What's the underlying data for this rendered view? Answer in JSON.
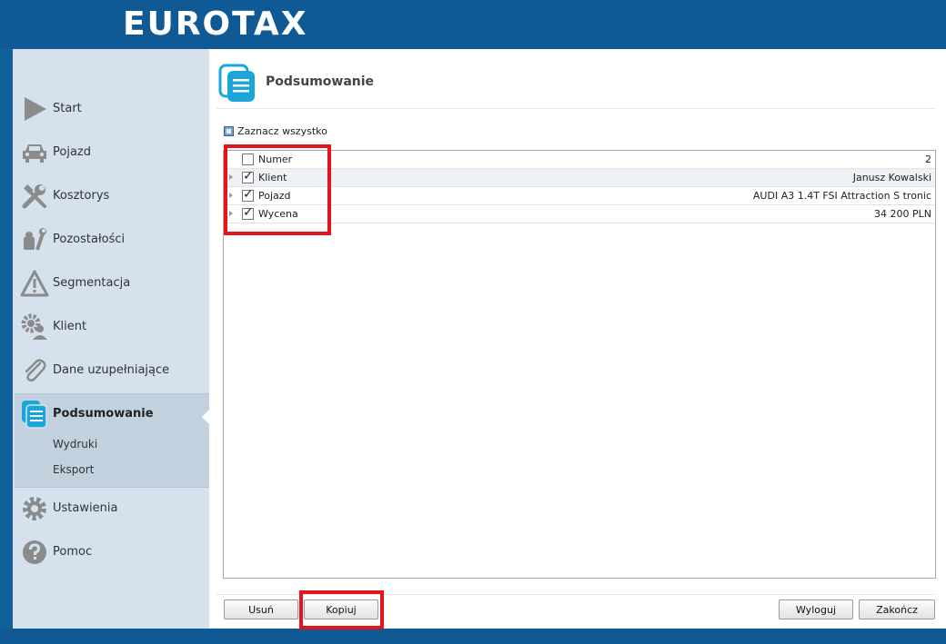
{
  "header": {
    "brand": "EUROTAX"
  },
  "sidebar": {
    "items": [
      {
        "label": "Start",
        "icon": "play-icon"
      },
      {
        "label": "Pojazd",
        "icon": "car-icon"
      },
      {
        "label": "Kosztorys",
        "icon": "tools-icon"
      },
      {
        "label": "Pozostałości",
        "icon": "residual-icon"
      },
      {
        "label": "Segmentacja",
        "icon": "warning-icon"
      },
      {
        "label": "Klient",
        "icon": "client-gear-icon"
      },
      {
        "label": "Dane uzupełniające",
        "icon": "paperclip-icon"
      },
      {
        "label": "Podsumowanie",
        "icon": "summary-icon",
        "active": true
      },
      {
        "label": "Ustawienia",
        "icon": "gear-icon"
      },
      {
        "label": "Pomoc",
        "icon": "help-icon"
      }
    ],
    "sub_items": [
      {
        "label": "Wydruki"
      },
      {
        "label": "Eksport"
      }
    ]
  },
  "main": {
    "title": "Podsumowanie",
    "select_all_label": "Zaznacz wszystko",
    "rows": [
      {
        "name": "Numer",
        "value": "2",
        "checked": false,
        "expandable": false
      },
      {
        "name": "Klient",
        "value": "Janusz Kowalski",
        "checked": true,
        "expandable": true
      },
      {
        "name": "Pojazd",
        "value": "AUDI A3 1.4T FSI Attraction S tronic",
        "checked": true,
        "expandable": true
      },
      {
        "name": "Wycena",
        "value": "34 200 PLN",
        "checked": true,
        "expandable": true
      }
    ],
    "buttons": {
      "remove": "Usuń",
      "copy": "Kopiuj",
      "logout": "Wyloguj",
      "finish": "Zakończ"
    }
  },
  "colors": {
    "brand_blue": "#0f5a94",
    "sidebar_bg": "#d5e2ed",
    "accent_cyan": "#1ba6d9",
    "highlight_red": "#e3141c"
  }
}
